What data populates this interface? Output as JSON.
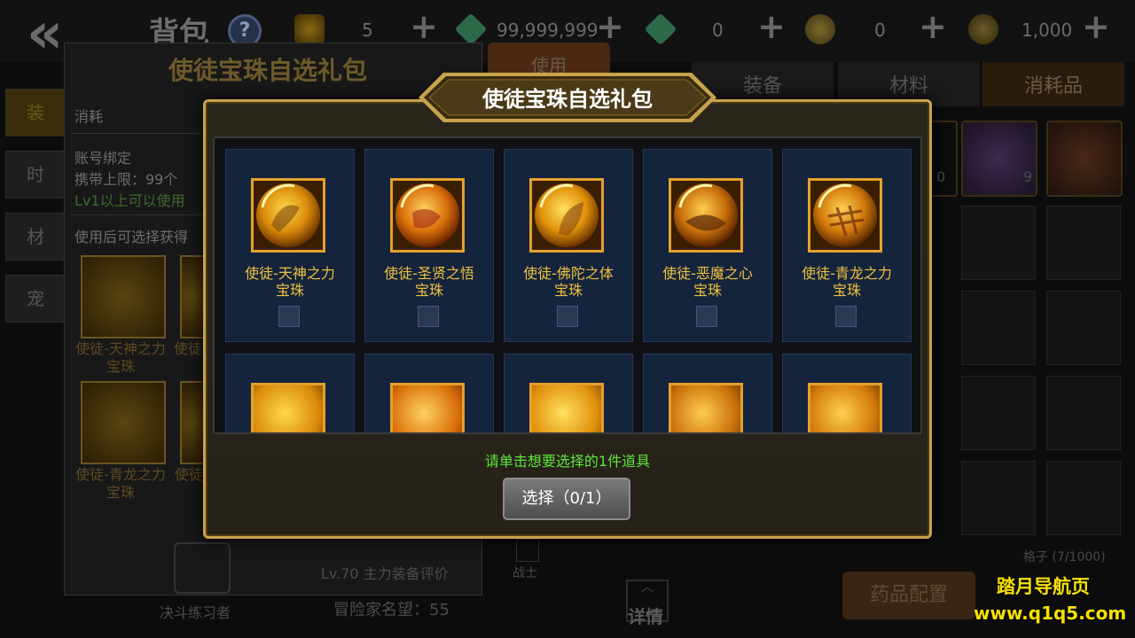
{
  "background": {
    "bag_title": "背包",
    "help": "?",
    "currencies": [
      {
        "value": "5",
        "plus": "+"
      },
      {
        "value": "99,999,999",
        "plus": "+"
      },
      {
        "value": "0",
        "plus": "+"
      },
      {
        "value": "0",
        "plus": "+"
      },
      {
        "value": "1,000",
        "plus": "+"
      }
    ],
    "use_button": "使用",
    "category_tabs": [
      "装备",
      "材料",
      "消耗品"
    ],
    "left_tabs": [
      "装",
      "时",
      "材",
      "宠"
    ],
    "detail_panel": {
      "title": "使徒宝珠自选礼包",
      "type": "消耗",
      "bind": "账号绑定",
      "carry_limit": "携带上限：99个",
      "level_req": "Lv1以上可以使用",
      "choose_text": "使用后可选择获得",
      "items": [
        "使徒-天神之力宝珠",
        "使徒-",
        "使徒-青龙之力宝珠",
        "使徒"
      ]
    },
    "capacity": "格子 (7/1000)",
    "slot_counts": [
      "0",
      "9"
    ],
    "player_name": "决斗练习者",
    "fame": "冒险家名望：55",
    "job": "战士",
    "config_button": "药品配置",
    "detail_button": "详情",
    "partial_text": "Lv.70 主力装备评价"
  },
  "modal": {
    "title": "使徒宝珠自选礼包",
    "items": [
      {
        "name": "使徒-天神之力\n宝珠",
        "checked": false
      },
      {
        "name": "使徒-圣贤之悟\n宝珠",
        "checked": false
      },
      {
        "name": "使徒-佛陀之体\n宝珠",
        "checked": false
      },
      {
        "name": "使徒-恶魔之心\n宝珠",
        "checked": false
      },
      {
        "name": "使徒-青龙之力\n宝珠",
        "checked": false
      },
      {
        "name": "",
        "checked": false
      },
      {
        "name": "",
        "checked": false
      },
      {
        "name": "",
        "checked": false
      },
      {
        "name": "",
        "checked": false
      },
      {
        "name": "",
        "checked": false
      }
    ],
    "hint": "请单击想要选择的1件道具",
    "select_button": "选择（0/1）"
  },
  "watermark": {
    "name": "踏月导航页",
    "url": "www.q1q5.com"
  }
}
